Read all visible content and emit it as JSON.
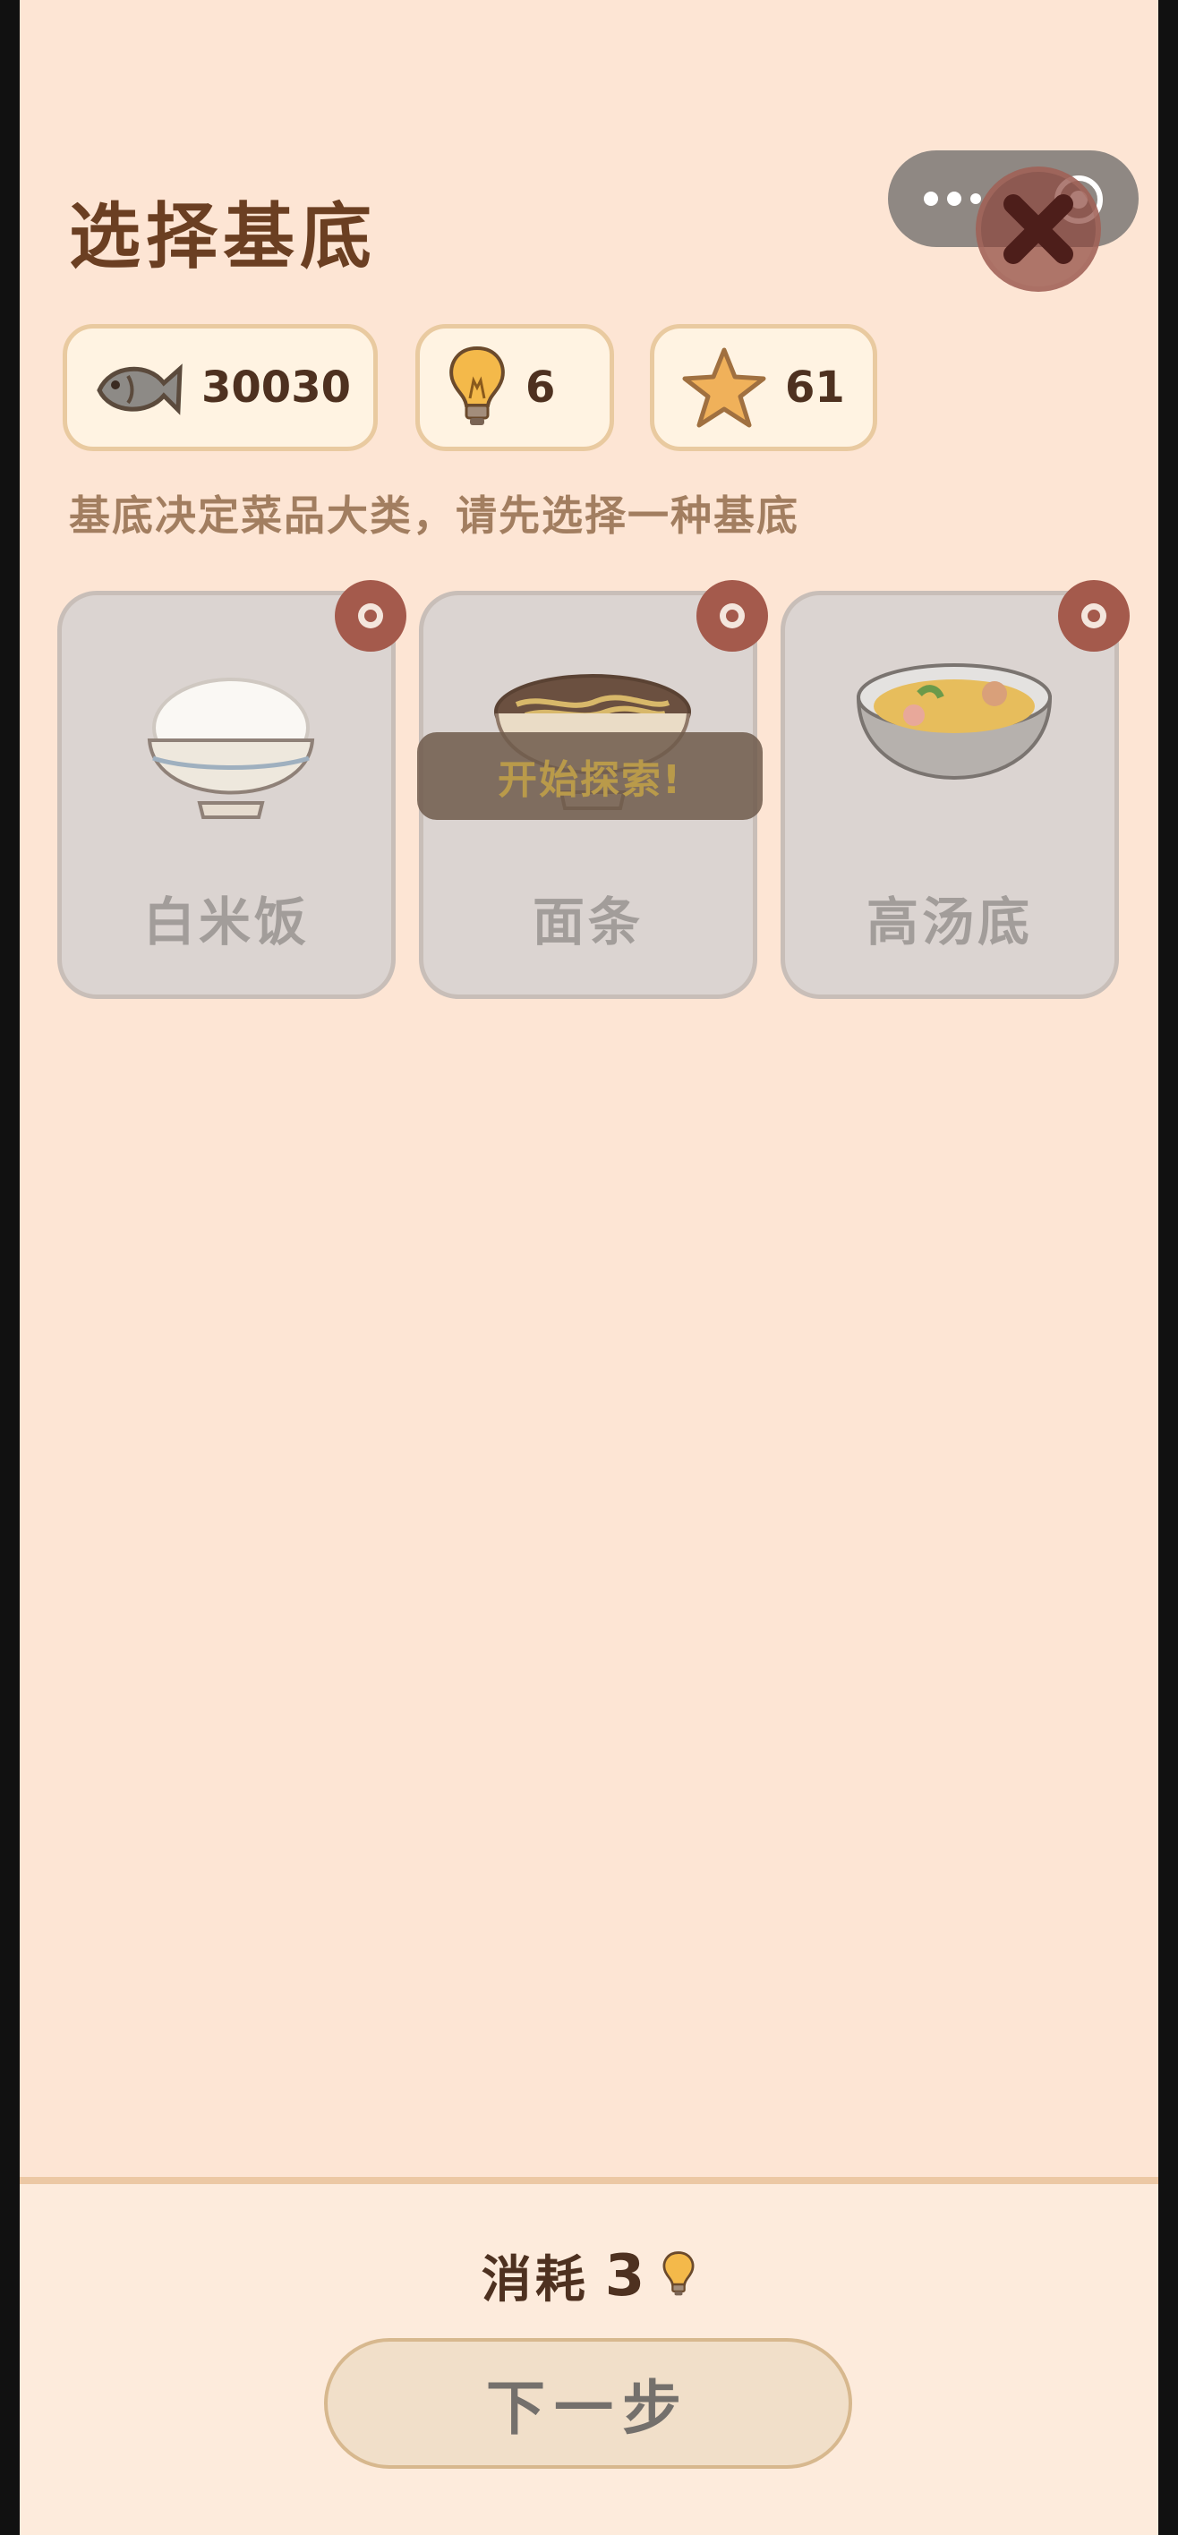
{
  "header": {
    "title": "选择基底"
  },
  "top_controls": {
    "menu_icon": "more-dots-icon",
    "capsule_close_icon": "target-icon",
    "close_button_icon": "close-x-icon"
  },
  "resources": [
    {
      "icon": "fish-icon",
      "value": "30030"
    },
    {
      "icon": "lightbulb-icon",
      "value": "6"
    },
    {
      "icon": "star-icon",
      "value": "61"
    }
  ],
  "hint": "基底决定菜品大类，请先选择一种基底",
  "bases": [
    {
      "name": "白米饭",
      "icon": "rice-bowl-icon",
      "locked": true
    },
    {
      "name": "面条",
      "icon": "noodle-bowl-icon",
      "locked": true
    },
    {
      "name": "高汤底",
      "icon": "soup-pot-icon",
      "locked": true
    }
  ],
  "toast": "开始探索!",
  "footer": {
    "cost_label": "消耗",
    "cost_value": "3",
    "cost_icon": "lightbulb-icon",
    "next_label": "下一步"
  },
  "colors": {
    "background": "#fde5d4",
    "title": "#6b3f22",
    "card": "#dbd4d1",
    "lock_badge": "#a45a4c"
  }
}
